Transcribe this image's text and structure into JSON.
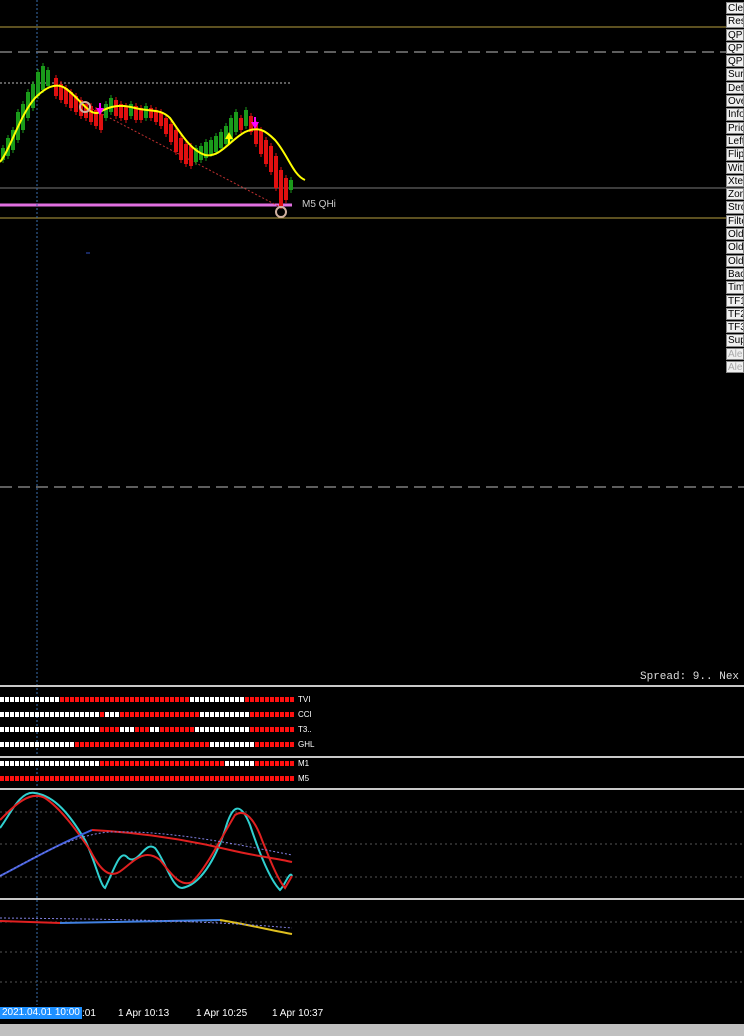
{
  "side_menu": {
    "items": [
      {
        "label": "Cle",
        "enabled": true
      },
      {
        "label": "Res",
        "enabled": true
      },
      {
        "label": "QP",
        "enabled": true
      },
      {
        "label": "QP",
        "enabled": true
      },
      {
        "label": "QP",
        "enabled": true
      },
      {
        "label": "Sur",
        "enabled": true
      },
      {
        "label": "Det",
        "enabled": true
      },
      {
        "label": "Ove",
        "enabled": true
      },
      {
        "label": "Info",
        "enabled": true
      },
      {
        "label": "Pric",
        "enabled": true
      },
      {
        "label": "Left",
        "enabled": true
      },
      {
        "label": "Flip",
        "enabled": true
      },
      {
        "label": "Wit",
        "enabled": true
      },
      {
        "label": "Xter",
        "enabled": true
      },
      {
        "label": "Zon",
        "enabled": true
      },
      {
        "label": "Stro",
        "enabled": true
      },
      {
        "label": "Filte",
        "enabled": true
      },
      {
        "label": "Old",
        "enabled": true
      },
      {
        "label": "Old",
        "enabled": true
      },
      {
        "label": "Old",
        "enabled": true
      },
      {
        "label": "Bac",
        "enabled": true
      },
      {
        "label": "Tim",
        "enabled": true
      },
      {
        "label": "TF1",
        "enabled": true
      },
      {
        "label": "TF2",
        "enabled": true
      },
      {
        "label": "TF3",
        "enabled": true
      },
      {
        "label": "Sup",
        "enabled": true
      },
      {
        "label": "Aler",
        "enabled": false
      },
      {
        "label": "Aler",
        "enabled": false
      }
    ]
  },
  "chart": {
    "level_label": "M5 QHi",
    "spread_text": "Spread: 9.. Nex",
    "colors": {
      "up": "#1a9a1a",
      "down": "#e01010",
      "ma": "#ffff00",
      "level": "#e070e0",
      "gold_line": "#b8a040"
    }
  },
  "signal_rows": [
    {
      "label": "TVI"
    },
    {
      "label": "CCI"
    },
    {
      "label": "T3.."
    },
    {
      "label": "GHL"
    }
  ],
  "tf_rows": [
    {
      "label": "M1"
    },
    {
      "label": "M5"
    }
  ],
  "time_axis": {
    "highlight": "2021.04.01 10:00",
    "ticks": [
      ":01",
      "1 Apr 10:13",
      "1 Apr 10:25",
      "1 Apr 10:37"
    ]
  }
}
